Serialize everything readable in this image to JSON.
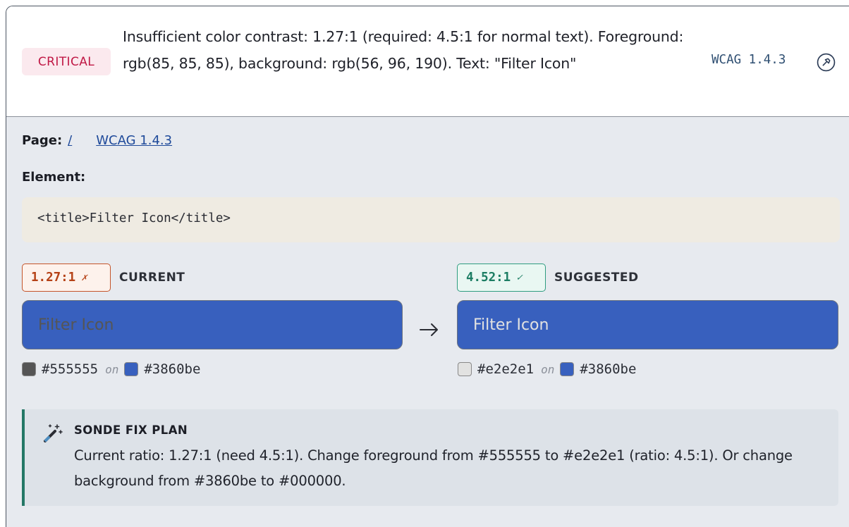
{
  "issue": {
    "severity": "CRITICAL",
    "description": "Insufficient color contrast: 1.27:1 (required: 4.5:1 for normal text). Foreground: rgb(85, 85, 85), background: rgb(56, 96, 190). Text: \"Filter Icon\"",
    "wcag_ref": "WCAG 1.4.3",
    "pin_icon": "pin-icon"
  },
  "details": {
    "page_label": "Page:",
    "page_link": "/",
    "wcag_link": "WCAG 1.4.3",
    "element_label": "Element:",
    "element_code": "<title>Filter Icon</title>"
  },
  "current": {
    "ratio": "1.27:1",
    "mark": "✗",
    "label": "CURRENT",
    "preview_text": "Filter Icon",
    "fg": "#555555",
    "bg": "#3860be",
    "on": "on"
  },
  "suggested": {
    "ratio": "4.52:1",
    "mark": "✓",
    "label": "SUGGESTED",
    "preview_text": "Filter Icon",
    "fg": "#e2e2e1",
    "bg": "#3860be",
    "on": "on"
  },
  "fix_plan": {
    "title": "SONDE FIX PLAN",
    "text": "Current ratio: 1.27:1 (need 4.5:1). Change foreground from #555555 to #e2e2e1 (ratio: 4.5:1). Or change background from #3860be to #000000.",
    "icon": "magic-wand-icon"
  }
}
